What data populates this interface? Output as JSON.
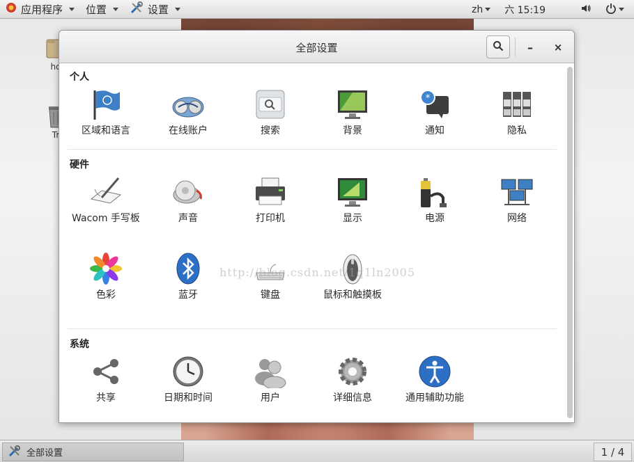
{
  "top_panel": {
    "apps_menu": "应用程序",
    "places_menu": "位置",
    "settings_menu": "设置",
    "lang": "zh",
    "clock": "六 15:19"
  },
  "desktop": {
    "icon1_label": "ho",
    "icon2_label": "Tr"
  },
  "window": {
    "title": "全部设置",
    "minimize_symbol": "–",
    "close_symbol": "×"
  },
  "sections": {
    "personal": {
      "title": "个人",
      "items": [
        "区域和语言",
        "在线账户",
        "搜索",
        "背景",
        "通知",
        "隐私"
      ]
    },
    "hardware": {
      "title": "硬件",
      "items": [
        "Wacom 手写板",
        "声音",
        "打印机",
        "显示",
        "电源",
        "网络",
        "色彩",
        "蓝牙",
        "键盘",
        "鼠标和触摸板"
      ]
    },
    "system": {
      "title": "系统",
      "items": [
        "共享",
        "日期和时间",
        "用户",
        "详细信息",
        "通用辅助功能"
      ]
    }
  },
  "watermark": "http://blog.csdn.net/1q1ln2005",
  "taskbar": {
    "task_label": "全部设置",
    "workspace": "1 / 4"
  },
  "icons": {
    "region": "flag-icon",
    "online": "globe-icon",
    "search": "search-icon",
    "background": "background-icon",
    "notifications": "notification-icon",
    "privacy": "privacy-icon",
    "wacom": "tablet-icon",
    "sound": "speaker-icon",
    "printer": "printer-icon",
    "display": "display-icon",
    "power": "battery-icon",
    "network": "network-icon",
    "color": "color-icon",
    "bluetooth": "bluetooth-icon",
    "keyboard": "keyboard-icon",
    "mouse": "mouse-icon",
    "sharing": "share-icon",
    "datetime": "clock-icon",
    "users": "users-icon",
    "details": "gear-icon",
    "accessibility": "accessibility-icon"
  }
}
